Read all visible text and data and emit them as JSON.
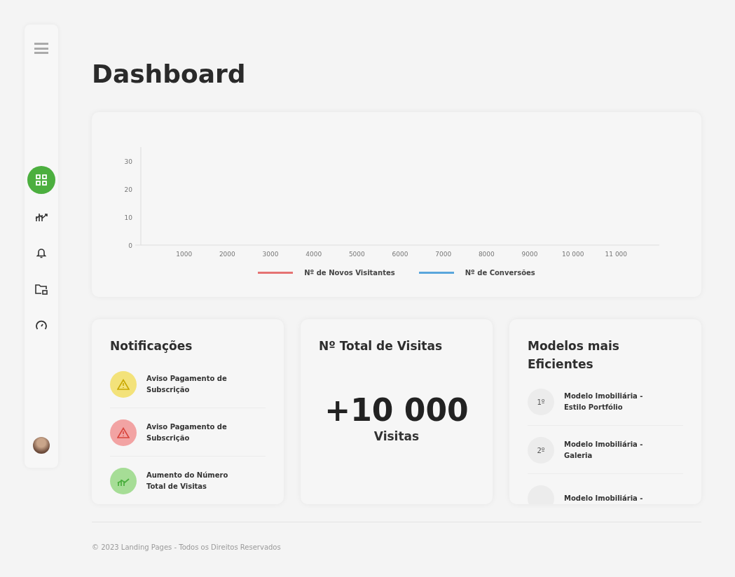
{
  "sidebar": {
    "items": [
      {
        "kind": "grid",
        "selected": true
      },
      {
        "kind": "chart",
        "selected": false
      },
      {
        "kind": "bell",
        "selected": false
      },
      {
        "kind": "folder",
        "selected": false
      },
      {
        "kind": "gauge",
        "selected": false
      }
    ]
  },
  "title": "Dashboard",
  "chart": {
    "chart_data": {
      "type": "line",
      "categories": [
        "1000",
        "2000",
        "3000",
        "4000",
        "5000",
        "6000",
        "7000",
        "8000",
        "9000",
        "10 000",
        "11 000"
      ],
      "yticks": [
        0,
        10,
        20,
        30
      ],
      "ylim": [
        0,
        35
      ],
      "series": [
        {
          "name": "Nº de Novos Visitantes",
          "color": "#e57373",
          "values": [
            null,
            null,
            null,
            null,
            null,
            null,
            null,
            null,
            null,
            null,
            null
          ]
        },
        {
          "name": "Nº de Conversões",
          "color": "#5aa6dc",
          "values": [
            null,
            null,
            null,
            null,
            null,
            null,
            null,
            null,
            null,
            null,
            null
          ]
        }
      ]
    }
  },
  "notifications": {
    "title": "Notificações",
    "items": [
      {
        "kind": "warning",
        "color": "#f3e27a",
        "text": "Aviso Pagamento de Subscrição"
      },
      {
        "kind": "alert",
        "color": "#f2a3a3",
        "text": "Aviso Pagamento de Subscrição"
      },
      {
        "kind": "growth",
        "color": "#a6dd96",
        "text": "Aumento do Número Total de Visitas"
      }
    ]
  },
  "visits": {
    "title": "Nº Total de Visitas",
    "value": "+10 000",
    "unit": "Visitas"
  },
  "models": {
    "title": "Modelos mais Eficientes",
    "items": [
      {
        "rank": "1º",
        "text": "Modelo Imobiliária - Estilo Portfólio"
      },
      {
        "rank": "2º",
        "text": "Modelo Imobiliária - Galeria"
      },
      {
        "text": "Modelo Imobiliária -"
      }
    ]
  },
  "footer": "© 2023 Landing Pages - Todos os Direitos Reservados"
}
